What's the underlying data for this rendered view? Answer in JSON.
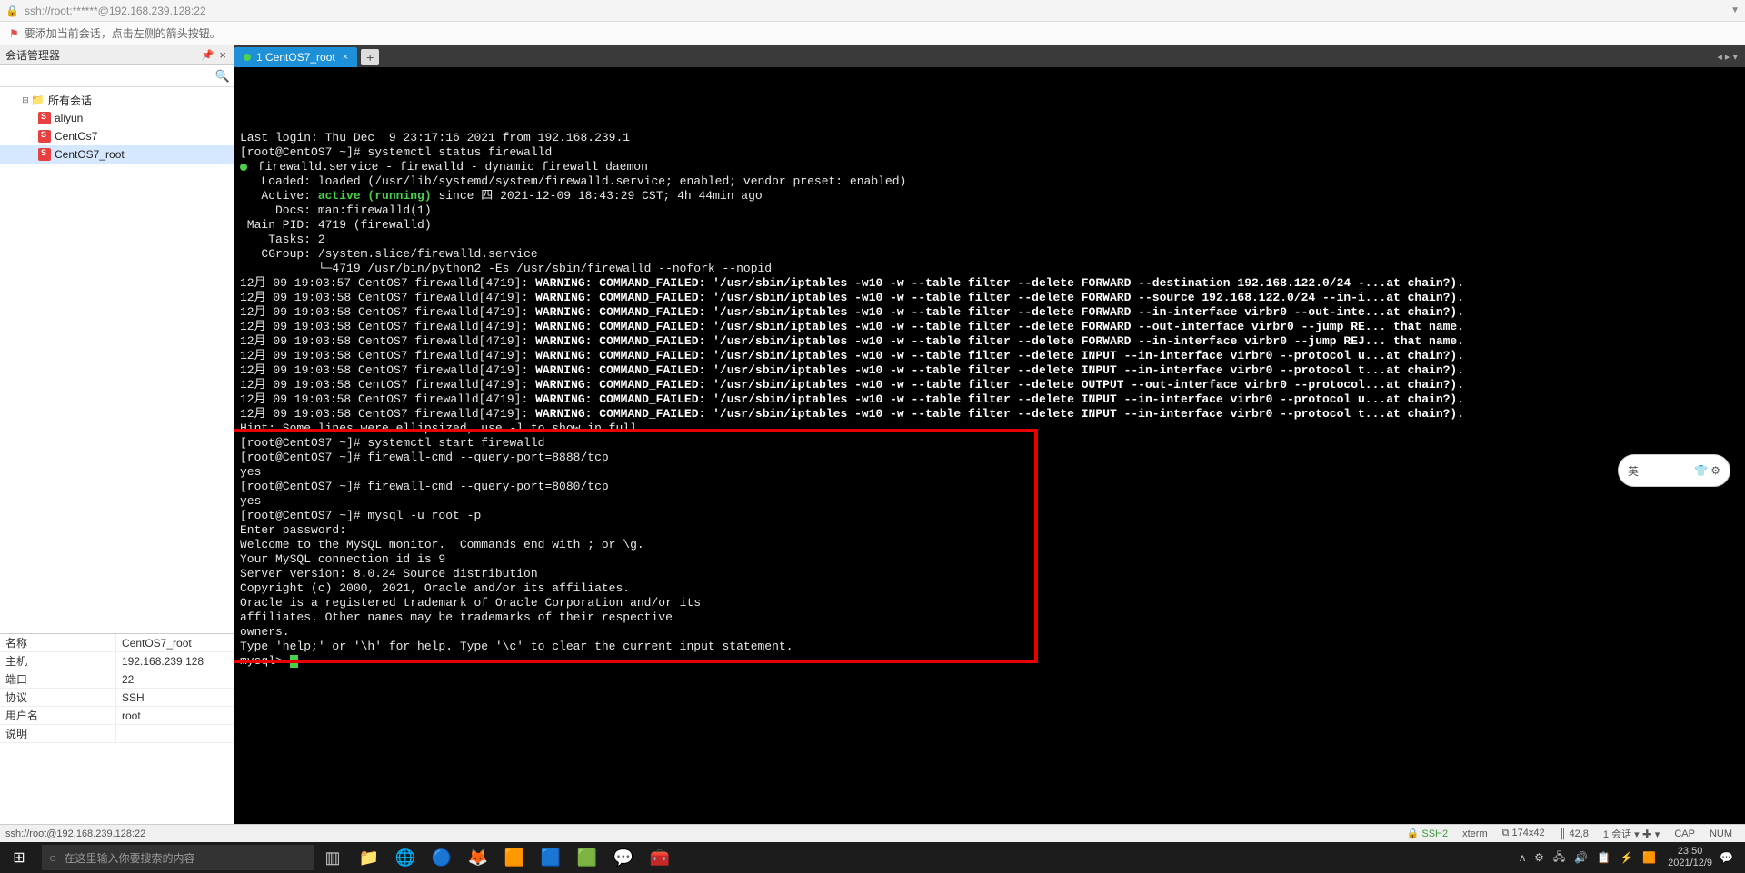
{
  "address": {
    "lock_icon": "lock-icon",
    "url": "ssh://root:******@192.168.239.128:22"
  },
  "hint": {
    "flag_icon": "flag-icon",
    "text": "要添加当前会话，点击左侧的箭头按钮。"
  },
  "sidebar": {
    "title": "会话管理器",
    "tree": {
      "root": "所有会话",
      "items": [
        "aliyun",
        "CentOs7",
        "CentOS7_root"
      ],
      "selected_index": 2
    },
    "props": [
      {
        "k": "名称",
        "v": "CentOS7_root"
      },
      {
        "k": "主机",
        "v": "192.168.239.128"
      },
      {
        "k": "端口",
        "v": "22"
      },
      {
        "k": "协议",
        "v": "SSH"
      },
      {
        "k": "用户名",
        "v": "root"
      },
      {
        "k": "说明",
        "v": ""
      }
    ]
  },
  "tabs": {
    "items": [
      {
        "label": "1 CentOS7_root",
        "active": true
      }
    ]
  },
  "terminal": {
    "lines": [
      {
        "t": "Last login: Thu Dec  9 23:17:16 2021 from 192.168.239.1"
      },
      {
        "t": "[root@CentOS7 ~]# systemctl status firewalld"
      },
      {
        "dot": true,
        "t": " firewalld.service - firewalld - dynamic firewall daemon"
      },
      {
        "t": "   Loaded: loaded (/usr/lib/systemd/system/firewalld.service; enabled; vendor preset: enabled)"
      },
      {
        "seg": [
          {
            "c": "",
            "t": "   Active: "
          },
          {
            "c": "t-gbold",
            "t": "active (running)"
          },
          {
            "c": "",
            "t": " since 四 2021-12-09 18:43:29 CST; 4h 44min ago"
          }
        ]
      },
      {
        "t": "     Docs: man:firewalld(1)"
      },
      {
        "t": " Main PID: 4719 (firewalld)"
      },
      {
        "t": "    Tasks: 2"
      },
      {
        "t": "   CGroup: /system.slice/firewalld.service"
      },
      {
        "t": "           └─4719 /usr/bin/python2 -Es /usr/sbin/firewalld --nofork --nopid"
      },
      {
        "t": ""
      },
      {
        "seg": [
          {
            "c": "",
            "t": "12月 09 19:03:57 CentOS7 firewalld[4719]: "
          },
          {
            "c": "t-wbold",
            "t": "WARNING: COMMAND_FAILED: '/usr/sbin/iptables -w10 -w --table filter --delete FORWARD --destination 192.168.122.0/24 -...at chain?)."
          }
        ]
      },
      {
        "seg": [
          {
            "c": "",
            "t": "12月 09 19:03:58 CentOS7 firewalld[4719]: "
          },
          {
            "c": "t-wbold",
            "t": "WARNING: COMMAND_FAILED: '/usr/sbin/iptables -w10 -w --table filter --delete FORWARD --source 192.168.122.0/24 --in-i...at chain?)."
          }
        ]
      },
      {
        "seg": [
          {
            "c": "",
            "t": "12月 09 19:03:58 CentOS7 firewalld[4719]: "
          },
          {
            "c": "t-wbold",
            "t": "WARNING: COMMAND_FAILED: '/usr/sbin/iptables -w10 -w --table filter --delete FORWARD --in-interface virbr0 --out-inte...at chain?)."
          }
        ]
      },
      {
        "seg": [
          {
            "c": "",
            "t": "12月 09 19:03:58 CentOS7 firewalld[4719]: "
          },
          {
            "c": "t-wbold",
            "t": "WARNING: COMMAND_FAILED: '/usr/sbin/iptables -w10 -w --table filter --delete FORWARD --out-interface virbr0 --jump RE... that name."
          }
        ]
      },
      {
        "seg": [
          {
            "c": "",
            "t": "12月 09 19:03:58 CentOS7 firewalld[4719]: "
          },
          {
            "c": "t-wbold",
            "t": "WARNING: COMMAND_FAILED: '/usr/sbin/iptables -w10 -w --table filter --delete FORWARD --in-interface virbr0 --jump REJ... that name."
          }
        ]
      },
      {
        "seg": [
          {
            "c": "",
            "t": "12月 09 19:03:58 CentOS7 firewalld[4719]: "
          },
          {
            "c": "t-wbold",
            "t": "WARNING: COMMAND_FAILED: '/usr/sbin/iptables -w10 -w --table filter --delete INPUT --in-interface virbr0 --protocol u...at chain?)."
          }
        ]
      },
      {
        "seg": [
          {
            "c": "",
            "t": "12月 09 19:03:58 CentOS7 firewalld[4719]: "
          },
          {
            "c": "t-wbold",
            "t": "WARNING: COMMAND_FAILED: '/usr/sbin/iptables -w10 -w --table filter --delete INPUT --in-interface virbr0 --protocol t...at chain?)."
          }
        ]
      },
      {
        "seg": [
          {
            "c": "",
            "t": "12月 09 19:03:58 CentOS7 firewalld[4719]: "
          },
          {
            "c": "t-wbold",
            "t": "WARNING: COMMAND_FAILED: '/usr/sbin/iptables -w10 -w --table filter --delete OUTPUT --out-interface virbr0 --protocol...at chain?)."
          }
        ]
      },
      {
        "seg": [
          {
            "c": "",
            "t": "12月 09 19:03:58 CentOS7 firewalld[4719]: "
          },
          {
            "c": "t-wbold",
            "t": "WARNING: COMMAND_FAILED: '/usr/sbin/iptables -w10 -w --table filter --delete INPUT --in-interface virbr0 --protocol u...at chain?)."
          }
        ]
      },
      {
        "seg": [
          {
            "c": "",
            "t": "12月 09 19:03:58 CentOS7 firewalld[4719]: "
          },
          {
            "c": "t-wbold",
            "t": "WARNING: COMMAND_FAILED: '/usr/sbin/iptables -w10 -w --table filter --delete INPUT --in-interface virbr0 --protocol t...at chain?)."
          }
        ]
      },
      {
        "t": "Hint: Some lines were ellipsized, use -l to show in full."
      },
      {
        "t": "[root@CentOS7 ~]# systemctl start firewalld"
      },
      {
        "t": "[root@CentOS7 ~]# firewall-cmd --query-port=8888/tcp"
      },
      {
        "t": "yes"
      },
      {
        "t": "[root@CentOS7 ~]# firewall-cmd --query-port=8080/tcp"
      },
      {
        "t": "yes"
      },
      {
        "t": "[root@CentOS7 ~]# mysql -u root -p"
      },
      {
        "t": "Enter password:"
      },
      {
        "t": "Welcome to the MySQL monitor.  Commands end with ; or \\g."
      },
      {
        "t": "Your MySQL connection id is 9"
      },
      {
        "t": "Server version: 8.0.24 Source distribution"
      },
      {
        "t": ""
      },
      {
        "t": "Copyright (c) 2000, 2021, Oracle and/or its affiliates."
      },
      {
        "t": ""
      },
      {
        "t": "Oracle is a registered trademark of Oracle Corporation and/or its"
      },
      {
        "t": "affiliates. Other names may be trademarks of their respective"
      },
      {
        "t": "owners."
      },
      {
        "t": ""
      },
      {
        "t": "Type 'help;' or '\\h' for help. Type '\\c' to clear the current input statement."
      },
      {
        "t": ""
      },
      {
        "seg": [
          {
            "c": "",
            "t": "mysql> "
          },
          {
            "cursor": true
          }
        ]
      }
    ]
  },
  "ime": {
    "label": "英"
  },
  "status": {
    "left": "ssh://root@192.168.239.128:22",
    "proto": "SSH2",
    "term": "xterm",
    "size": "174x42",
    "pos": "42,8",
    "sess": "1 会话",
    "cap": "CAP",
    "num": "NUM"
  },
  "taskbar": {
    "search_placeholder": "在这里输入你要搜索的内容",
    "clock": {
      "time": "23:50",
      "date": "2021/12/9"
    }
  }
}
